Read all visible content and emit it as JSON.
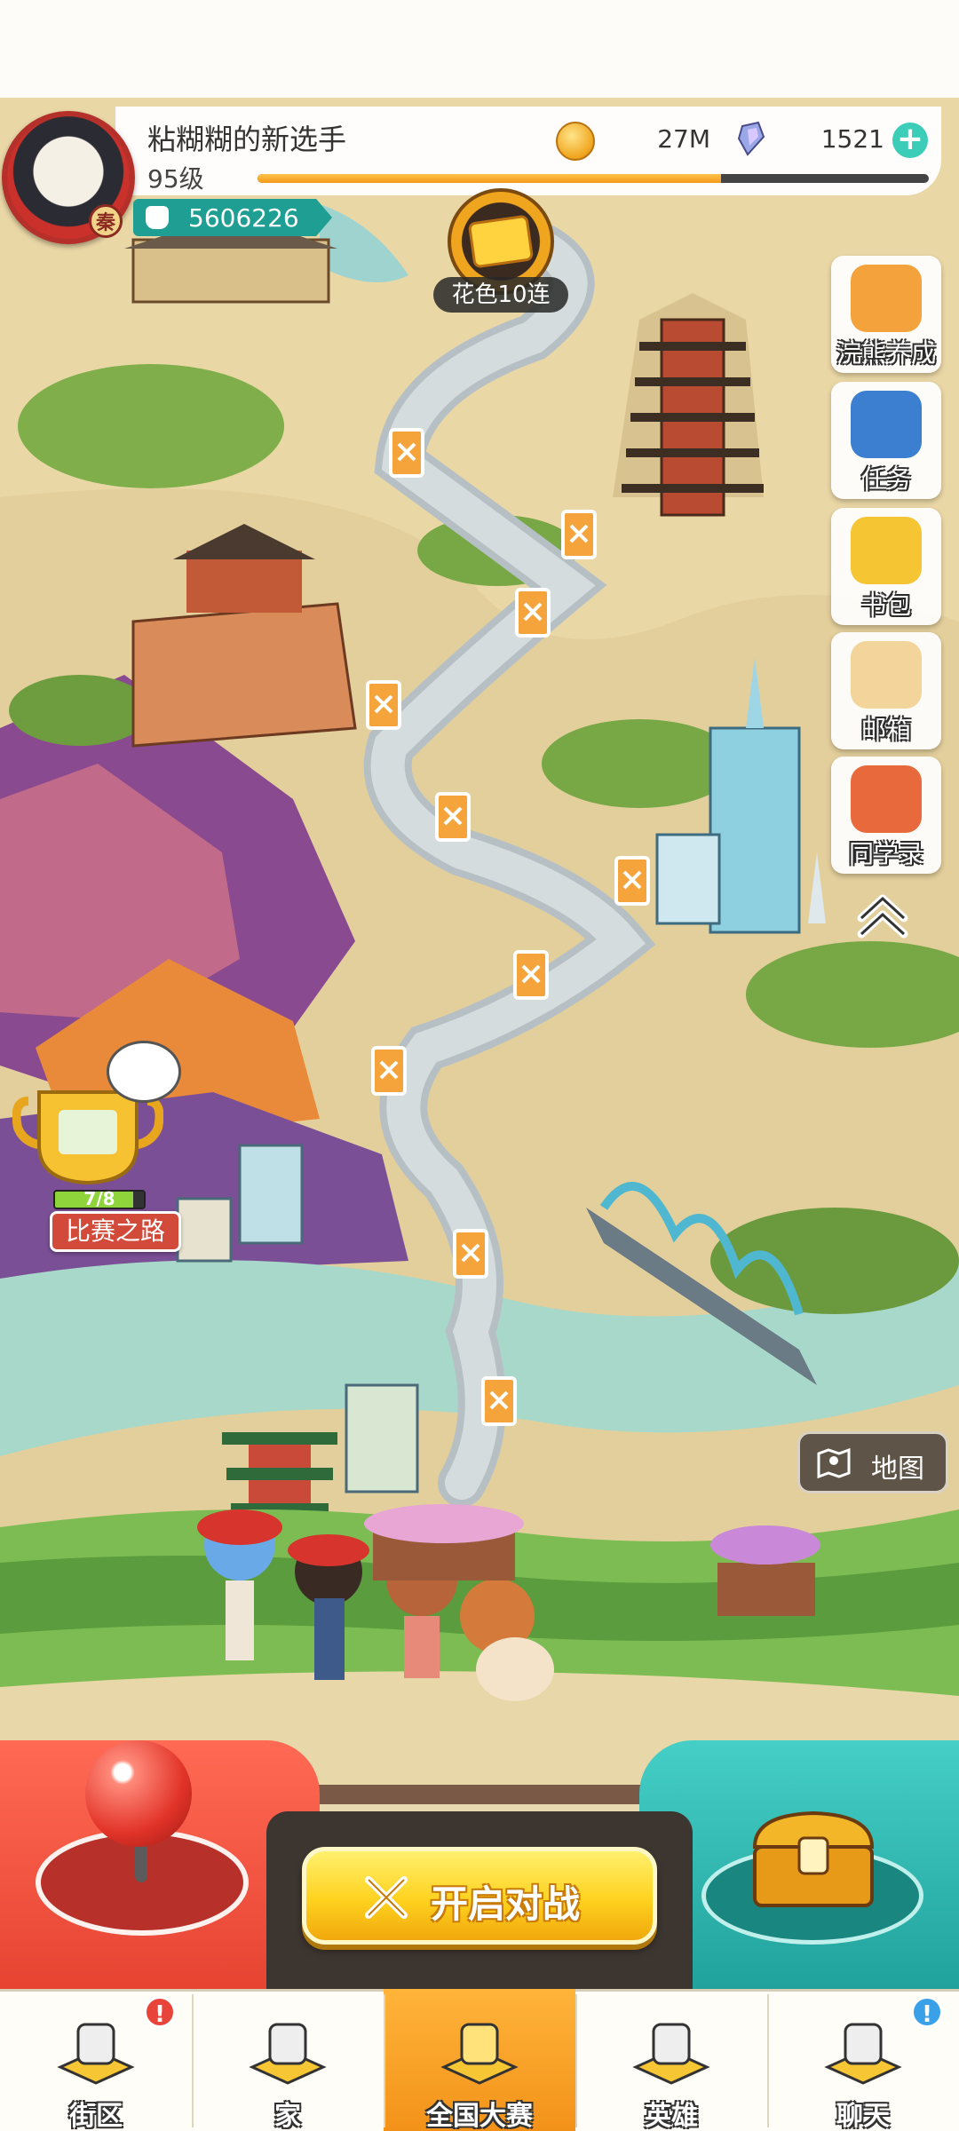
{
  "player": {
    "name": "粘糊糊的新选手",
    "level": "95级",
    "avatar_badge": "秦",
    "power": "5606226",
    "xp_fraction": 0.69
  },
  "currencies": {
    "coins": "27M",
    "gems": "1521"
  },
  "event": {
    "label": "花色10连"
  },
  "side_menu": [
    {
      "id": "raccoon",
      "label": "浣熊养成",
      "icon": "raccoon-icon",
      "color": "#f4a23c"
    },
    {
      "id": "tasks",
      "label": "任务",
      "icon": "clipboard-icon",
      "color": "#3c7fd1"
    },
    {
      "id": "bag",
      "label": "书包",
      "icon": "backpack-icon",
      "color": "#f6c534"
    },
    {
      "id": "mail",
      "label": "邮箱",
      "icon": "envelope-icon",
      "color": "#f3d49a"
    },
    {
      "id": "classmates",
      "label": "同学录",
      "icon": "classmates-icon",
      "color": "#e86a3c"
    }
  ],
  "tournament": {
    "progress": "7/8",
    "progress_fraction": 0.875,
    "label": "比赛之路"
  },
  "map_button": {
    "label": "地图"
  },
  "battle_button": {
    "label": "开启对战"
  },
  "bottom_nav": [
    {
      "id": "street",
      "label": "街区",
      "icon": "signpost-icon",
      "badge": "!",
      "badge_color": "#e8443a",
      "active": false
    },
    {
      "id": "home",
      "label": "家",
      "icon": "house-icon",
      "badge": "",
      "active": false
    },
    {
      "id": "national",
      "label": "全国大赛",
      "icon": "trophy-icon",
      "badge": "",
      "active": true
    },
    {
      "id": "heroes",
      "label": "英雄",
      "icon": "cards-icon",
      "badge": "",
      "active": false
    },
    {
      "id": "chat",
      "label": "聊天",
      "icon": "chat-bubble-icon",
      "badge": "!",
      "badge_color": "#3aa0e8",
      "active": false
    }
  ],
  "colors": {
    "accent": "#f39a1a",
    "teal": "#1f9e93",
    "battle": "#ffd21f"
  }
}
